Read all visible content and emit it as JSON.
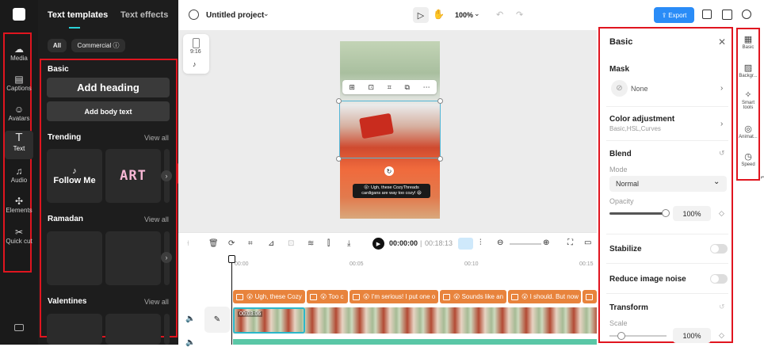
{
  "rail": {
    "items": [
      {
        "label": "Media",
        "icon": "cloud-icon"
      },
      {
        "label": "Captions",
        "icon": "captions-icon"
      },
      {
        "label": "Avatars",
        "icon": "avatar-icon"
      },
      {
        "label": "Text",
        "icon": "text-icon"
      },
      {
        "label": "Audio",
        "icon": "music-icon"
      },
      {
        "label": "Elements",
        "icon": "elements-icon"
      },
      {
        "label": "Quick cut",
        "icon": "quick-cut-icon"
      }
    ]
  },
  "panel": {
    "tabs": [
      "Text templates",
      "Text effects"
    ],
    "filters": [
      "All",
      "Commercial ⓘ"
    ],
    "basic_title": "Basic",
    "add_heading": "Add heading",
    "add_body": "Add body text",
    "trending_title": "Trending",
    "view_all": "View all",
    "trending_tiles": [
      "Follow Me",
      "ART"
    ],
    "ramadan_title": "Ramadan",
    "valentines_title": "Valentines"
  },
  "topbar": {
    "project_title": "Untitled project",
    "zoom": "100%",
    "export_label": "Export"
  },
  "canvas": {
    "ratio_label": "9:16",
    "caption_text": "😮: Ugh, these CozyThreads cardigans are way too cozy! 😆"
  },
  "timeline": {
    "current_time": "00:00:00",
    "total_time": "00:18:13",
    "ruler": [
      "00:00",
      "00:05",
      "00:10",
      "00:15"
    ],
    "captions": [
      "😮 Ugh, these Cozy",
      "😮 Too c",
      "😮 I'm serious! I put one o",
      "😮 Sounds like an",
      "😮 I should. But now"
    ],
    "clip_time": "00:03:06"
  },
  "right_panel": {
    "title": "Basic",
    "mask_label": "Mask",
    "mask_value": "None",
    "color_adj_label": "Color adjustment",
    "color_adj_sub": "Basic,HSL,Curves",
    "blend_label": "Blend",
    "mode_label": "Mode",
    "mode_value": "Normal",
    "opacity_label": "Opacity",
    "opacity_value": "100%",
    "stabilize_label": "Stabilize",
    "noise_label": "Reduce image noise",
    "transform_label": "Transform",
    "scale_label": "Scale",
    "scale_value": "100%"
  },
  "far_rail": {
    "items": [
      "Basic",
      "Backgr...",
      "Smart tools",
      "Animat...",
      "Speed"
    ]
  },
  "colors": {
    "accent": "#2a8cf7",
    "highlight": "#e0151f",
    "caption_clip": "#e8833c"
  }
}
